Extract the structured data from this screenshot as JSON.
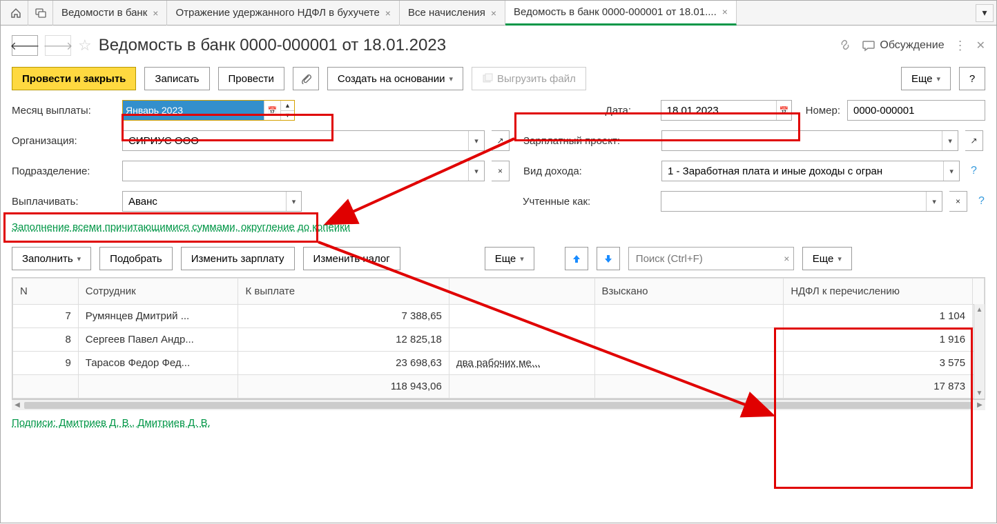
{
  "tabs": {
    "t1": "Ведомости в банк",
    "t2": "Отражение удержанного НДФЛ в бухучете",
    "t3": "Все начисления",
    "t4": "Ведомость в банк 0000-000001 от 18.01...."
  },
  "page": {
    "title": "Ведомость в банк 0000-000001 от 18.01.2023",
    "discuss": "Обсуждение"
  },
  "toolbar": {
    "provest_zakryt": "Провести и закрыть",
    "zapisat": "Записать",
    "provesti": "Провести",
    "sozdatna": "Создать на основании",
    "vygruzit": "Выгрузить файл",
    "eshe": "Еще",
    "q": "?"
  },
  "form": {
    "mesyac_label": "Месяц выплаты:",
    "mesyac_value": "Январь 2023",
    "data_label": "Дата:",
    "data_value": "18.01.2023",
    "nomer_label": "Номер:",
    "nomer_value": "0000-000001",
    "org_label": "Организация:",
    "org_value": "СИРИУС ООО",
    "zp_label": "Зарплатный проект:",
    "podr_label": "Подразделение:",
    "vid_label": "Вид дохода:",
    "vid_value": "1 - Заработная плата и иные доходы с огран",
    "vyp_label": "Выплачивать:",
    "vyp_value": "Аванс",
    "uchten_label": "Учтенные как:",
    "fill_link": "Заполнение всеми причитающимися суммами, округление до копейки"
  },
  "tabletoolbar": {
    "zapolnit": "Заполнить",
    "podobrat": "Подобрать",
    "izm_zp": "Изменить зарплату",
    "izm_nalog": "Изменить налог",
    "eshe": "Еще",
    "search_ph": "Поиск (Ctrl+F)"
  },
  "table": {
    "h_n": "N",
    "h_sotr": "Сотрудник",
    "h_kvyp": "К выплате",
    "h_vzysk": "Взыскано",
    "h_ndfl": "НДФЛ к перечислению",
    "rows": [
      {
        "n": "7",
        "sotr": "Румянцев Дмитрий ...",
        "kvyp": "7 388,65",
        "note": "",
        "ndfl": "1 104"
      },
      {
        "n": "8",
        "sotr": "Сергеев Павел Андр...",
        "kvyp": "12 825,18",
        "note": "",
        "ndfl": "1 916"
      },
      {
        "n": "9",
        "sotr": "Тарасов Федор Фед...",
        "kvyp": "23 698,63",
        "note": "два рабочих ме...",
        "ndfl": "3 575"
      }
    ],
    "total_kvyp": "118 943,06",
    "total_ndfl": "17 873"
  },
  "footer": {
    "podpisi": "Подписи: Дмитриев Д. В., Дмитриев Д. В."
  }
}
